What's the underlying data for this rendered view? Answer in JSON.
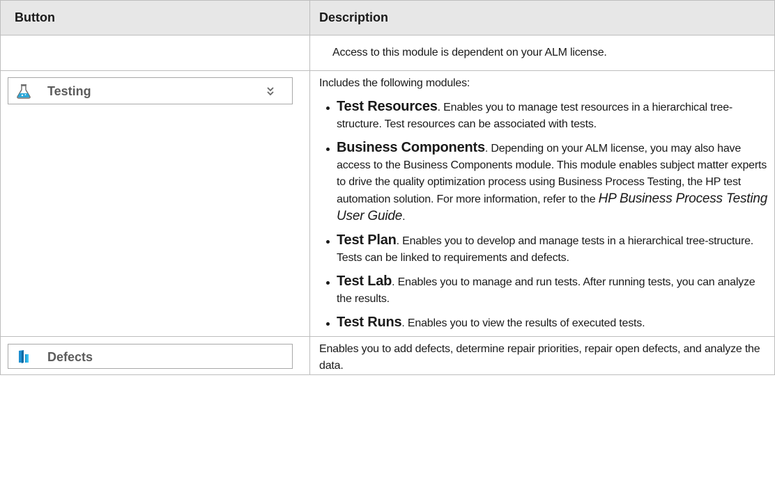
{
  "table": {
    "headers": {
      "button": "Button",
      "description": "Description"
    },
    "row1": {
      "description": "Access to this module is dependent on your ALM license."
    },
    "testing": {
      "button_label": "Testing",
      "intro": "Includes the following modules:",
      "items": [
        {
          "title": "Test Resources",
          "text": ". Enables you to manage test resources in a hierarchical tree-structure. Test resources can be associated with tests."
        },
        {
          "title": "Business Components",
          "text": ". Depending on your ALM license, you may also have access to the Business Components module. This module enables subject matter experts to drive the quality optimization process using Business Process Testing, the HP test automation solution. For more information, refer to the ",
          "guide": "HP Business Process Testing User Guide",
          "tail": "."
        },
        {
          "title": "Test Plan",
          "text": ". Enables you to develop and manage tests in a hierarchical tree-structure. Tests can be linked to requirements and defects."
        },
        {
          "title": "Test Lab",
          "text": ". Enables you to manage and run tests. After running tests, you can analyze the results."
        },
        {
          "title": "Test Runs",
          "text": ". Enables you to view the results of executed tests."
        }
      ]
    },
    "defects": {
      "button_label": "Defects",
      "description": "Enables you to add defects, determine repair priorities, repair open defects, and analyze the data."
    }
  },
  "icons": {
    "testing": "flask-icon",
    "expand": "double-chevron-down-icon",
    "defects": "defects-icon"
  },
  "colors": {
    "header_bg": "#e7e7e7",
    "border": "#bdbdbd",
    "flask_accent": "#2aa7d8",
    "defects_accent": "#1e8fd0"
  }
}
